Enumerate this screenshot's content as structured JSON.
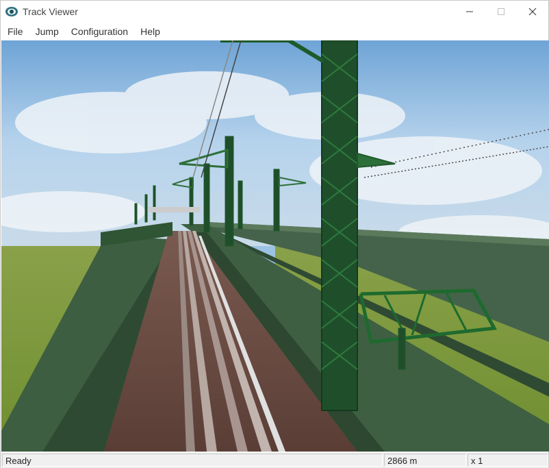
{
  "window": {
    "title": "Track Viewer",
    "icon": "track-viewer-app-icon",
    "controls": [
      "minimize-icon",
      "maximize-icon",
      "close-icon"
    ]
  },
  "menu": {
    "items": [
      {
        "label": "File"
      },
      {
        "label": "Jump"
      },
      {
        "label": "Configuration"
      },
      {
        "label": "Help"
      }
    ]
  },
  "viewport": {
    "scene": "3d-railway-view",
    "colors": {
      "sky": "#a9cbe8",
      "grass": "#7f9a37",
      "girder": "#3a5a3c",
      "mast": "#1e5a2a",
      "rail": "#8a6a60",
      "sleepers": "#6e4a3e"
    }
  },
  "status": {
    "text": "Ready",
    "distance": "2866 m",
    "speed": "x 1"
  }
}
